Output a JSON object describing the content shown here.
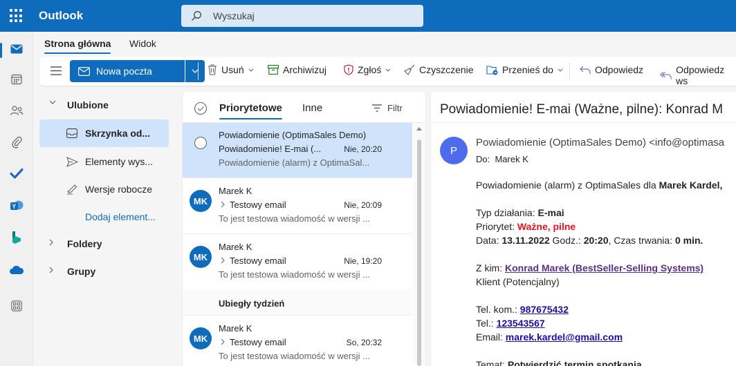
{
  "app": {
    "name": "Outlook"
  },
  "search": {
    "placeholder": "Wyszukaj"
  },
  "tabs": [
    {
      "label": "Strona główna"
    },
    {
      "label": "Widok"
    }
  ],
  "ribbon": {
    "new_mail": "Nowa poczta",
    "delete": "Usuń",
    "archive": "Archiwizuj",
    "report": "Zgłoś",
    "sweep": "Czyszczenie",
    "move": "Przenieś do",
    "reply": "Odpowiedz",
    "reply_all": "Odpowiedz ws"
  },
  "folders": {
    "favorites": "Ulubione",
    "items": [
      {
        "label": "Skrzynka od..."
      },
      {
        "label": "Elementy wys..."
      },
      {
        "label": "Wersje robocze"
      }
    ],
    "add_item": "Dodaj element...",
    "folders_group": "Foldery",
    "groups_group": "Grupy"
  },
  "list": {
    "tab_focused": "Priorytetowe",
    "tab_other": "Inne",
    "filter": "Filtr",
    "last_week": "Ubiegły tydzień",
    "messages": [
      {
        "sender": "Powiadomienie (OptimaSales Demo)",
        "subject": "Powiadomienie! E-mai (...",
        "time": "Nie, 20:20",
        "preview": "Powiadomienie (alarm) z OptimaSal..."
      },
      {
        "initials": "MK",
        "sender": "Marek K",
        "subject": "Testowy email",
        "time": "Nie, 20:09",
        "preview": "To jest testowa wiadomość w wersji ..."
      },
      {
        "initials": "MK",
        "sender": "Marek K",
        "subject": "Testowy email",
        "time": "Nie, 19:20",
        "preview": "To jest testowa wiadomość w wersji ..."
      },
      {
        "initials": "MK",
        "sender": "Marek K",
        "subject": "Testowy email",
        "time": "So, 20:32",
        "preview": "To jest testowa wiadomość w wersji ..."
      }
    ]
  },
  "reading": {
    "subject": "Powiadomienie! E-mai (Ważne, pilne): Konrad M",
    "avatar": "P",
    "from": "Powiadomienie (OptimaSales Demo) <info@optimasa",
    "to_label": "Do:",
    "to": "Marek K",
    "intro": "Powiadomienie (alarm) z OptimaSales dla ",
    "intro_name": "Marek Kardel,",
    "type_label": "Typ działania: ",
    "type_value": "E-mai",
    "priority_label": "Priorytet: ",
    "priority_value": "Ważne, pilne",
    "date_label": "Data: ",
    "date_value": "13.11.2022",
    "time_label": " Godz.: ",
    "time_value": "20:20",
    "duration_label": ", Czas trwania: ",
    "duration_value": "0 min.",
    "with_label": "Z kim: ",
    "with_value": "Konrad Marek (BestSeller-Selling Systems)",
    "client": "Klient (Potencjalny)",
    "mobile_label": "Tel. kom.: ",
    "mobile_value": "987675432",
    "phone_label": "Tel.: ",
    "phone_value": "123543567",
    "email_label": "Email: ",
    "email_value": "marek.kardel@gmail.com",
    "topic_label": "Temat: ",
    "topic_value": "Potwierdzić termin spotkania"
  },
  "colors": {
    "brand": "#0f6cbd",
    "selected": "#cfe4fa",
    "urgent": "#e81123"
  }
}
